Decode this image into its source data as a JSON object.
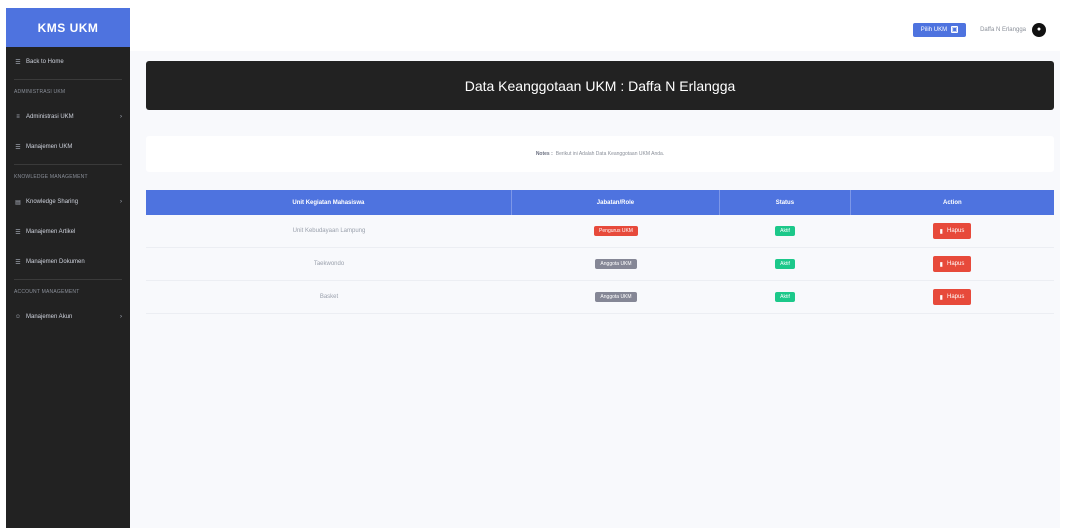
{
  "app": {
    "brand": "KMS UKM"
  },
  "sidebar": {
    "items": [
      {
        "type": "item",
        "icon": "grid-icon",
        "label": "Back to Home",
        "chevron": false
      },
      {
        "type": "section",
        "label": "Administrasi UKM"
      },
      {
        "type": "item",
        "icon": "list-icon",
        "label": "Administrasi UKM",
        "chevron": true
      },
      {
        "type": "item",
        "icon": "grid-icon",
        "label": "Manajemen UKM",
        "chevron": false
      },
      {
        "type": "section",
        "label": "Knowledge Management"
      },
      {
        "type": "item",
        "icon": "doc-icon",
        "label": "Knowledge Sharing",
        "chevron": true
      },
      {
        "type": "item",
        "icon": "grid-icon",
        "label": "Manajemen Artikel",
        "chevron": false
      },
      {
        "type": "item",
        "icon": "grid-icon",
        "label": "Manajemen Dokumen",
        "chevron": false
      },
      {
        "type": "section",
        "label": "Account Management"
      },
      {
        "type": "item",
        "icon": "user-icon",
        "label": "Manajemen Akun",
        "chevron": true
      }
    ]
  },
  "topbar": {
    "button_label": "Pilih UKM",
    "user_name": "Daffa N Erlangga"
  },
  "main": {
    "title": "Data Keanggotaan UKM : Daffa N Erlangga",
    "note_label": "Notes :",
    "note_text": "Berikut ini Adalah Data Keanggotaan UKM Anda.",
    "table": {
      "columns": [
        "Unit Kegiatan Mahasiswa",
        "Jabatan/Role",
        "Status",
        "Action"
      ],
      "rows": [
        {
          "ukm": "Unit Kebudayaan Lampung",
          "role": "Pengurus UKM",
          "role_color": "red",
          "status": "Aktif",
          "action": "Hapus"
        },
        {
          "ukm": "Taekwondo",
          "role": "Anggota UKM",
          "role_color": "gray",
          "status": "Aktif",
          "action": "Hapus"
        },
        {
          "ukm": "Basket",
          "role": "Anggota UKM",
          "role_color": "gray",
          "status": "Aktif",
          "action": "Hapus"
        }
      ]
    }
  },
  "colors": {
    "primary": "#4e73df",
    "danger": "#e74a3b",
    "success": "#1cc88a",
    "secondary": "#858796",
    "dark": "#222222"
  }
}
